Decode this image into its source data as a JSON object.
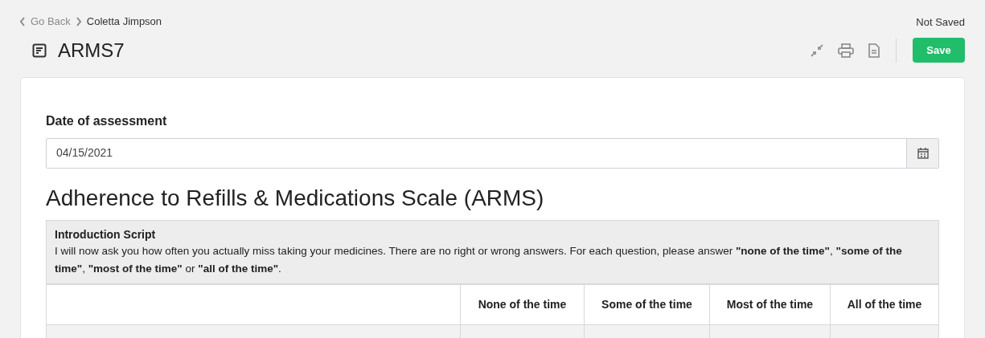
{
  "breadcrumb": {
    "back": "Go Back",
    "current": "Coletta Jimpson"
  },
  "save_status": "Not Saved",
  "title": "ARMS7",
  "toolbar": {
    "save_button": "Save"
  },
  "date_field": {
    "label": "Date of assessment",
    "value": "04/15/2021"
  },
  "section_title": "Adherence to Refills & Medications Scale (ARMS)",
  "intro": {
    "heading": "Introduction Script",
    "text": "I will now ask you how often you actually miss taking your medicines. There are no right or wrong answers. For each question, please answer **\"none of the time\"**, **\"some of the time\"**, **\"most of the time\"** or **\"all of the time\"**."
  },
  "table": {
    "columns": [
      "None of the time",
      "Some of the time",
      "Most of the time",
      "All of the time"
    ]
  }
}
